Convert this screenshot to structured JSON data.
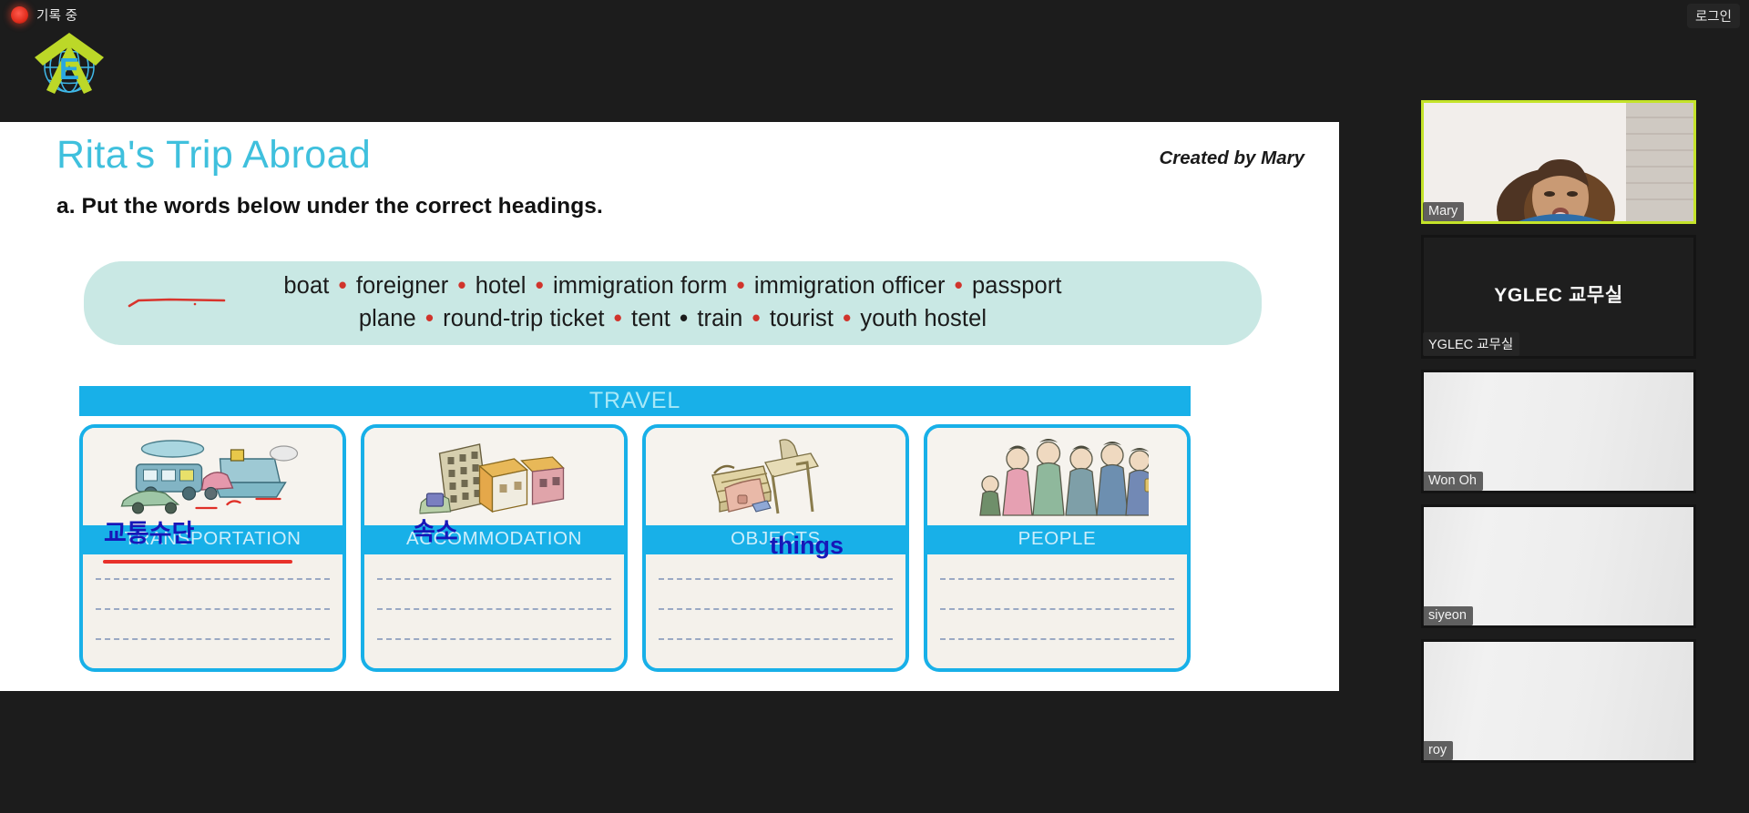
{
  "topbar": {
    "recording_label": "기록 중",
    "recording_icon": "record-dot-icon",
    "login_label": "로그인"
  },
  "logo": {
    "icon": "yglec-globe-arrow-logo"
  },
  "slide": {
    "title": "Rita's Trip Abroad",
    "credit": "Created by Mary",
    "instruction": "a. Put the words below under the correct headings.",
    "wordbank": {
      "line1": [
        "boat",
        "foreigner",
        "hotel",
        "immigration form",
        "immigration officer",
        "passport"
      ],
      "line2": [
        "plane",
        "round-trip ticket",
        "tent",
        "train",
        "tourist",
        "youth hostel"
      ],
      "separator": "•",
      "separator_color": "#d0342c"
    },
    "banner": {
      "text": "TRAVEL",
      "color": "#18b0e8"
    },
    "categories": [
      {
        "label": "TRANSPORTATION",
        "art": "vehicles-bus-car-boat-icon",
        "annotation": "교통수단",
        "lines": 3,
        "has_red_underline": true
      },
      {
        "label": "ACCOMMODATION",
        "art": "buildings-hotel-houses-icon",
        "annotation": "속소",
        "lines": 3,
        "has_red_underline": false
      },
      {
        "label": "OBJECTS",
        "art": "suitcase-luggage-icon",
        "annotation": "things",
        "lines": 3,
        "has_red_underline": false
      },
      {
        "label": "PEOPLE",
        "art": "queue-of-people-icon",
        "annotation": "",
        "lines": 3,
        "has_red_underline": false
      }
    ],
    "annotation_color": "#1717b8"
  },
  "participants": [
    {
      "name": "Mary",
      "display": "tag",
      "active_speaker": true,
      "video": "webcam"
    },
    {
      "name": "YGLEC 교무실",
      "display": "center",
      "active_speaker": false,
      "video": "off"
    },
    {
      "name": "Won Oh",
      "display": "tag",
      "active_speaker": false,
      "video": "blank"
    },
    {
      "name": "siyeon",
      "display": "tag",
      "active_speaker": false,
      "video": "blank"
    },
    {
      "name": "roy",
      "display": "tag",
      "active_speaker": false,
      "video": "blank"
    }
  ],
  "cursor": {
    "icon": "mouse-pointer-icon"
  }
}
